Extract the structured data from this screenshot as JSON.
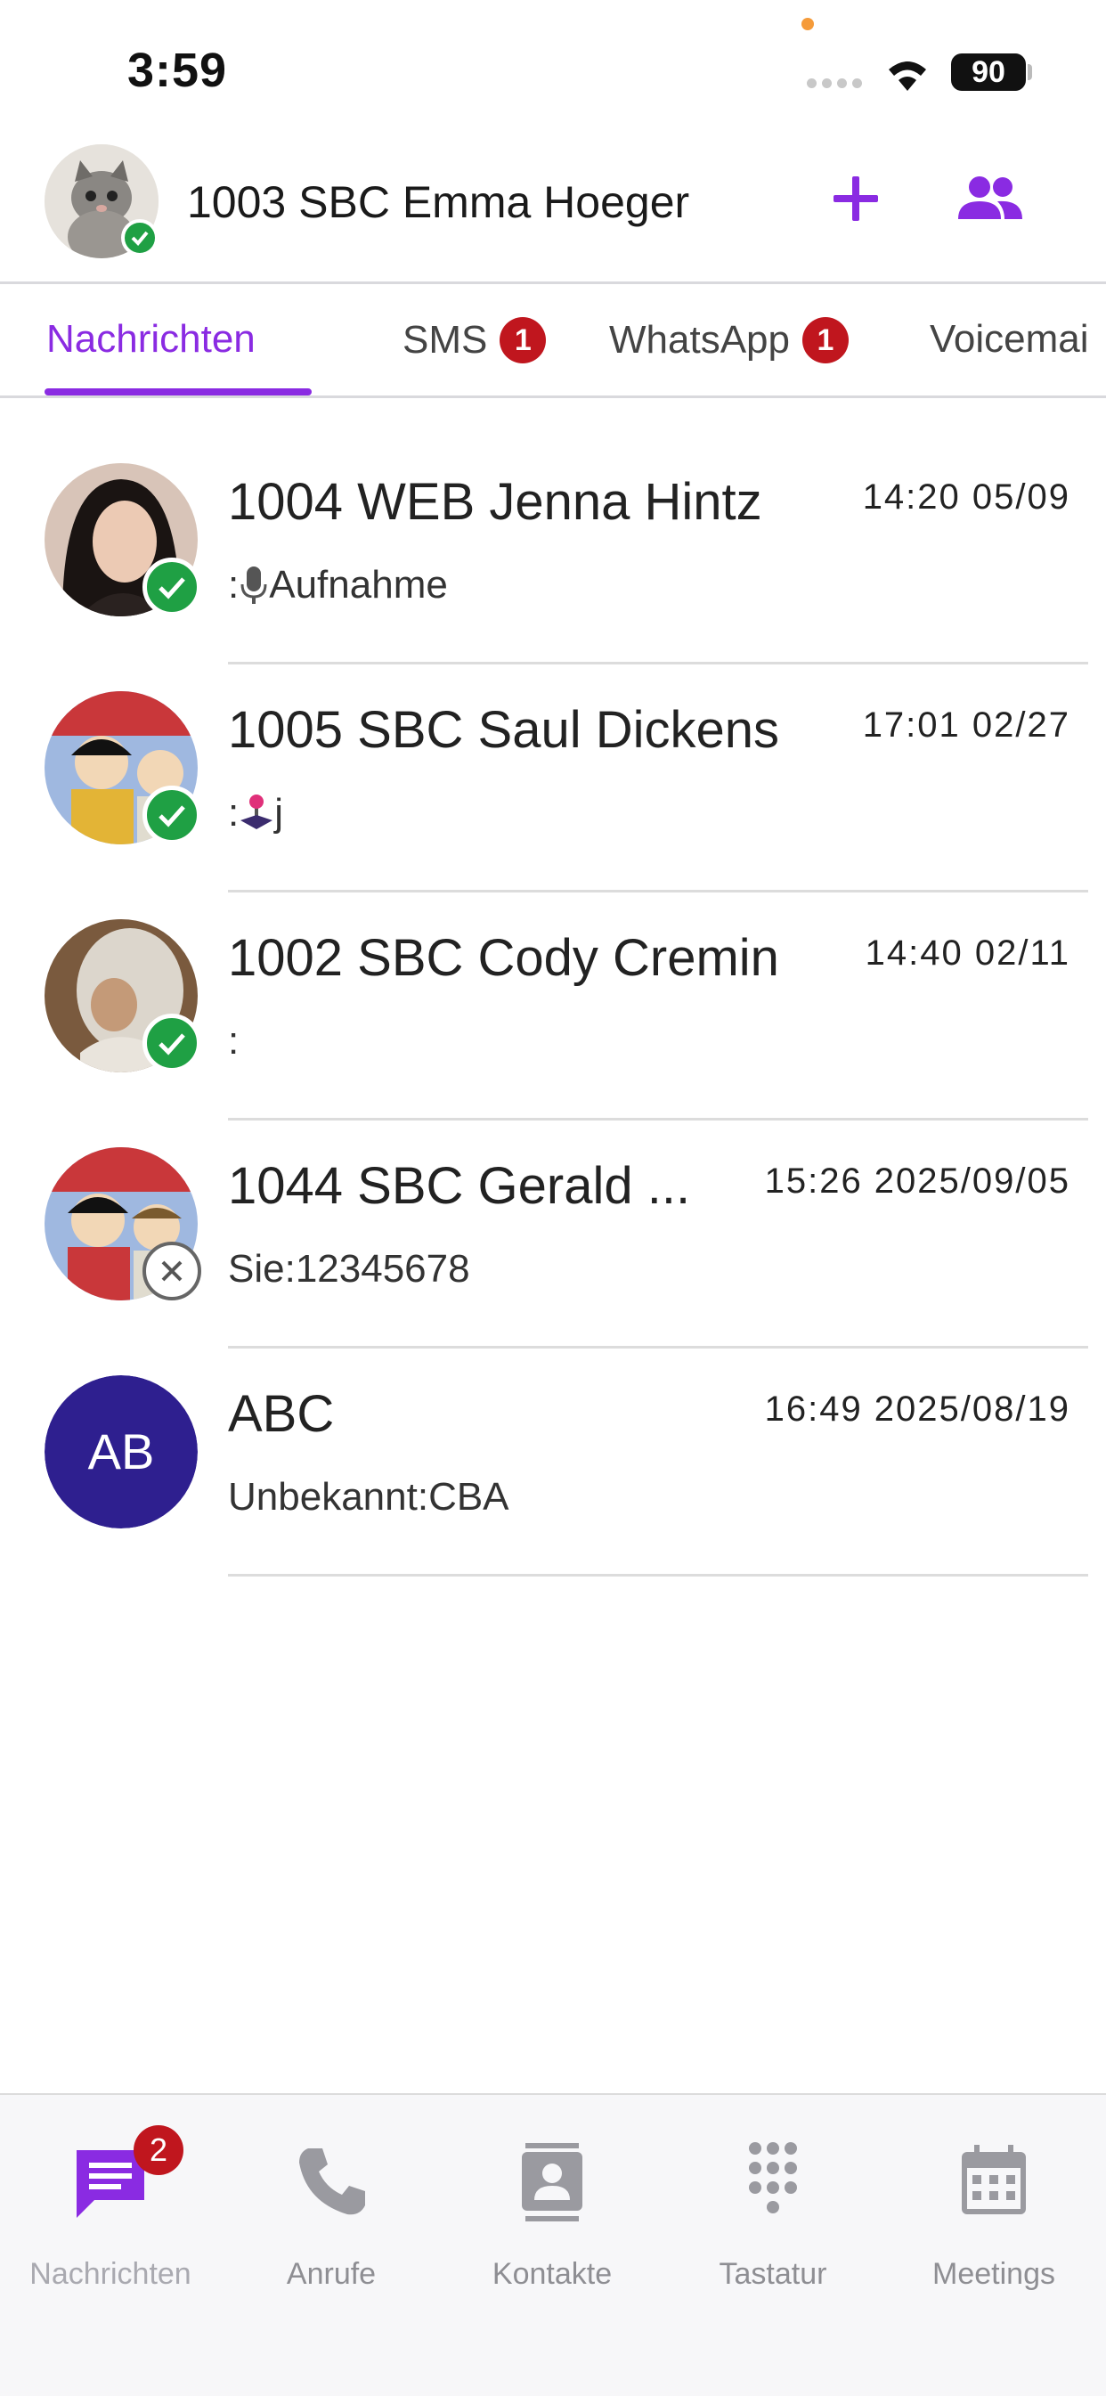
{
  "status_bar": {
    "time": "3:59",
    "battery": "90"
  },
  "header": {
    "title": "1003 SBC Emma Hoeger"
  },
  "tabs": [
    {
      "label": "Nachrichten",
      "badge": ""
    },
    {
      "label": "SMS",
      "badge": "1"
    },
    {
      "label": "WhatsApp",
      "badge": "1"
    },
    {
      "label": "Voicemai",
      "badge": ""
    }
  ],
  "conversations": [
    {
      "name": "1004 WEB Jenna Hintz",
      "time": "14:20  05/09",
      "preview_prefix": ":",
      "preview_text": " Aufnahme",
      "status": "online"
    },
    {
      "name": "1005 SBC Saul Dickens",
      "time": "17:01  02/27",
      "preview_prefix": ":",
      "preview_text": "j",
      "status": "online"
    },
    {
      "name": "1002 SBC Cody Cremin",
      "time": "14:40  02/11",
      "preview_prefix": ":",
      "preview_text": "",
      "status": "online"
    },
    {
      "name": "1044 SBC Gerald ...",
      "time": "15:26  2025/09/05",
      "preview_prefix": "Sie:",
      "preview_text": "12345678",
      "status": "offline"
    },
    {
      "name": "ABC",
      "time": "16:49  2025/08/19",
      "preview_prefix": "Unbekannt:",
      "preview_text": "CBA",
      "initials": "AB",
      "status": "none"
    }
  ],
  "bottom_nav": [
    {
      "label": "Nachrichten",
      "icon": "message-icon",
      "badge": "2"
    },
    {
      "label": "Anrufe",
      "icon": "phone-icon"
    },
    {
      "label": "Kontakte",
      "icon": "contact-card-icon"
    },
    {
      "label": "Tastatur",
      "icon": "dialpad-icon"
    },
    {
      "label": "Meetings",
      "icon": "calendar-icon"
    }
  ],
  "colors": {
    "accent": "#8a2be2",
    "badge": "#c0161e",
    "online": "#1fa044",
    "initials_bg": "#2e1f8f"
  }
}
